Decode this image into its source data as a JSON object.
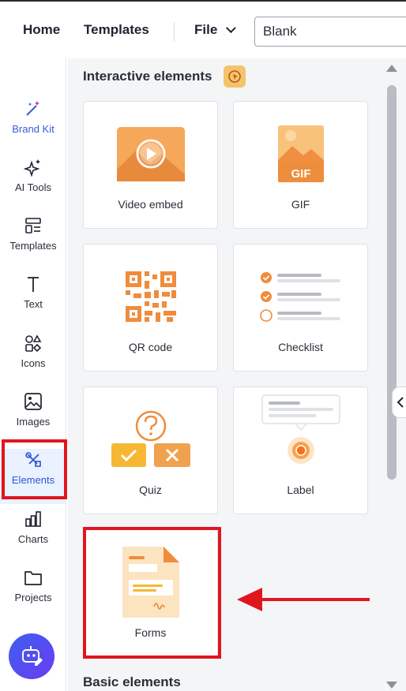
{
  "topbar": {
    "home": "Home",
    "templates": "Templates",
    "file": "File",
    "title_value": "Blank"
  },
  "rail": {
    "items": [
      {
        "label": "Brand Kit",
        "icon": "magic-wand-icon"
      },
      {
        "label": "AI Tools",
        "icon": "sparkle-icon"
      },
      {
        "label": "Templates",
        "icon": "templates-icon"
      },
      {
        "label": "Text",
        "icon": "text-icon"
      },
      {
        "label": "Icons",
        "icon": "shapes-icon"
      },
      {
        "label": "Images",
        "icon": "image-icon"
      },
      {
        "label": "Elements",
        "icon": "elements-icon"
      },
      {
        "label": "Charts",
        "icon": "chart-icon"
      },
      {
        "label": "Projects",
        "icon": "folder-icon"
      }
    ],
    "active": "Elements"
  },
  "panel": {
    "interactive_title": "Interactive elements",
    "basic_title": "Basic elements",
    "cards": [
      {
        "label": "Video embed"
      },
      {
        "label": "GIF",
        "art_text": "GIF"
      },
      {
        "label": "QR code"
      },
      {
        "label": "Checklist"
      },
      {
        "label": "Quiz"
      },
      {
        "label": "Label"
      },
      {
        "label": "Forms"
      }
    ]
  },
  "colors": {
    "accent_orange": "#f0a04b",
    "highlight_red": "#e0161e",
    "active_blue": "#2b57d6"
  }
}
